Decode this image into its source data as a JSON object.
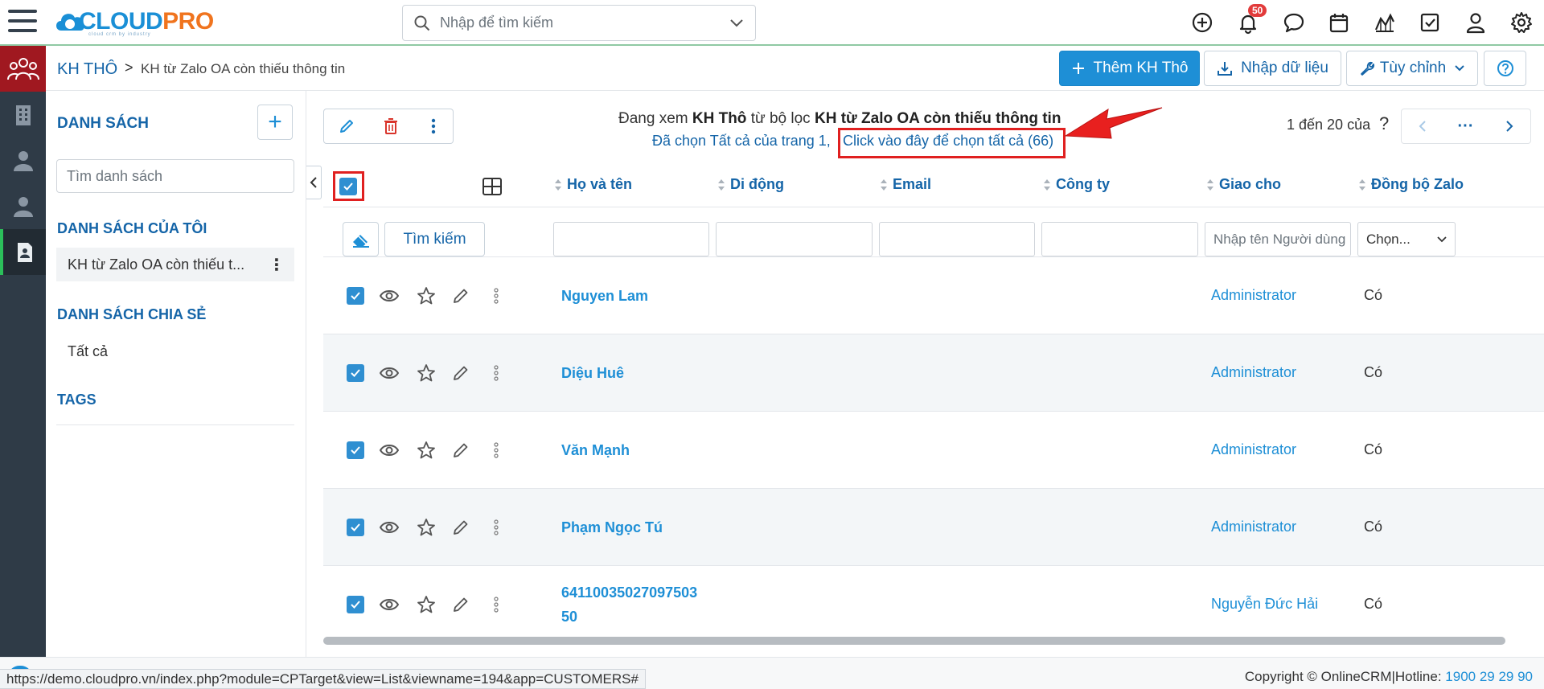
{
  "app": {
    "logo_text_a": "CLOUD",
    "logo_text_b": "PRO",
    "logo_tagline": "cloud crm by industry"
  },
  "topbar": {
    "search_placeholder": "Nhập để tìm kiếm",
    "notification_count": "50",
    "icons": [
      "add-circle-icon",
      "bell-icon",
      "chat-icon",
      "calendar-icon",
      "report-chart-icon",
      "task-check-icon",
      "user-icon",
      "gear-icon"
    ]
  },
  "breadcrumb": {
    "root": "KH THÔ",
    "separator": ">",
    "leaf": "KH từ Zalo OA còn thiếu thông tin"
  },
  "actions": {
    "add_label": "Thêm KH Thô",
    "import_label": "Nhập dữ liệu",
    "customize_label": "Tùy chỉnh"
  },
  "sidebar": {
    "title": "DANH SÁCH",
    "add_symbol": "+",
    "search_placeholder": "Tìm danh sách",
    "my_lists_title": "DANH SÁCH CỦA TÔI",
    "my_list_item": "KH từ Zalo OA còn thiếu t...",
    "shared_title": "DANH SÁCH CHIA SẺ",
    "shared_item": "Tất cả",
    "tags_title": "TAGS"
  },
  "info": {
    "viewing_prefix": "Đang xem ",
    "module": "KH Thô",
    "filter_prefix": " từ bộ lọc ",
    "filter_name": "KH từ Zalo OA còn thiếu thông tin",
    "selected_text": "Đã chọn Tất cả của trang 1,",
    "select_all_link": "Click vào đây để chọn tất cả (66)"
  },
  "paging": {
    "range_text": "1 đến 20 của",
    "help": "?",
    "more": "···"
  },
  "table": {
    "columns": [
      "Họ và tên",
      "Di động",
      "Email",
      "Công ty",
      "Giao cho",
      "Đồng bộ Zalo"
    ],
    "search_button": "Tìm kiếm",
    "owner_filter_placeholder": "Nhập tên Người dùng hoặc",
    "zalo_filter_placeholder": "Chọn...",
    "rows": [
      {
        "name": "Nguyen Lam",
        "owner": "Administrator",
        "zalo": "Có"
      },
      {
        "name": "Diệu Huê",
        "owner": "Administrator",
        "zalo": "Có"
      },
      {
        "name": "Văn Mạnh",
        "owner": "Administrator",
        "zalo": "Có"
      },
      {
        "name": "Phạm Ngọc Tú",
        "owner": "Administrator",
        "zalo": "Có"
      },
      {
        "name": "6411003502709750350",
        "name_line1": "64110035027097503",
        "name_line2": "50",
        "owner": "Nguyễn Đức Hải",
        "zalo": "Có"
      }
    ]
  },
  "status": {
    "url": "https://demo.cloudpro.vn/index.php?module=CPTarget&view=List&viewname=194&app=CUSTOMERS#",
    "copyright": "Copyright © OnlineCRM|Hotline: ",
    "hotline": "1900 29 29 90"
  },
  "colors": {
    "primary": "#1e8fd6",
    "link": "#1565a8",
    "rail": "#2f3b47",
    "highlight_red": "#e02020",
    "checkbox": "#2f8fd1"
  }
}
